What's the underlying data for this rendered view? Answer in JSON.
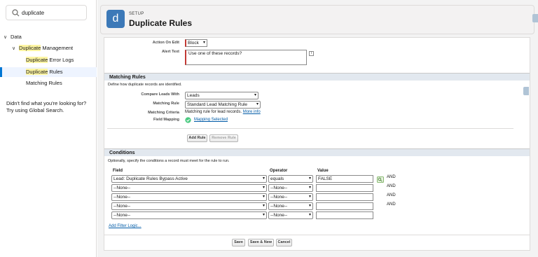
{
  "search": {
    "value": "duplicate",
    "icon": "search-icon"
  },
  "sidebar": {
    "tree": [
      {
        "label": "Data",
        "highlight": "",
        "rest": ""
      },
      {
        "label": "",
        "highlight": "Duplicate",
        "rest": " Management"
      },
      {
        "label": "",
        "highlight": "Duplicate",
        "rest": " Error Logs"
      },
      {
        "label": "",
        "highlight": "Duplicate",
        "rest": " Rules"
      },
      {
        "label": "Matching Rules",
        "highlight": "",
        "rest": ""
      }
    ],
    "help_line1": "Didn't find what you're looking for?",
    "help_line2": "Try using Global Search."
  },
  "header": {
    "tile_letter": "d",
    "setup_label": "SETUP",
    "title": "Duplicate Rules"
  },
  "rule_actions": {
    "action_on_edit_label": "Action On Edit",
    "action_on_edit_value": "Block",
    "alert_text_label": "Alert Text",
    "alert_text_value": "Use one of these records?",
    "info_label": "i"
  },
  "matching": {
    "section_title": "Matching Rules",
    "description": "Define how duplicate records are identified.",
    "compare_label": "Compare Leads With",
    "compare_value": "Leads",
    "rule_label": "Matching Rule",
    "rule_value": "Standard Lead Matching Rule",
    "criteria_label": "Matching Criteria",
    "criteria_text": "Matching rule for lead records.",
    "more_info": "More info",
    "mapping_label": "Field Mapping",
    "mapping_value": "Mapping Selected",
    "add_rule": "Add Rule",
    "remove_rule": "Remove Rule"
  },
  "conditions": {
    "section_title": "Conditions",
    "description": "Optionally, specify the conditions a record must meet for the rule to run.",
    "headers": {
      "field": "Field",
      "operator": "Operator",
      "value": "Value"
    },
    "rows": [
      {
        "field": "Lead: Duplicate Rules Bypass Active",
        "operator": "equals",
        "value": "FALSE",
        "conj": "AND"
      },
      {
        "field": "--None--",
        "operator": "--None--",
        "value": "",
        "conj": "AND"
      },
      {
        "field": "--None--",
        "operator": "--None--",
        "value": "",
        "conj": "AND"
      },
      {
        "field": "--None--",
        "operator": "--None--",
        "value": "",
        "conj": "AND"
      },
      {
        "field": "--None--",
        "operator": "--None--",
        "value": "",
        "conj": ""
      }
    ],
    "add_filter_logic": "Add Filter Logic..."
  },
  "footer": {
    "save": "Save",
    "save_new": "Save & New",
    "cancel": "Cancel"
  },
  "colors": {
    "accent": "#0176d3",
    "tile": "#3c79b8",
    "required": "#c23934",
    "highlight": "#fdf5a3",
    "section": "#e2e8ef"
  }
}
